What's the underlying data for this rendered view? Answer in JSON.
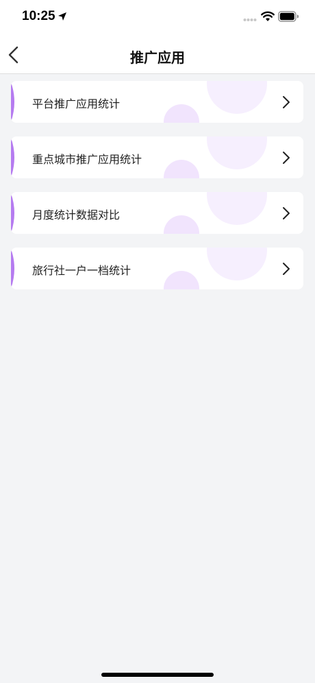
{
  "status_bar": {
    "time": "10:25",
    "icons": [
      "location-arrow-icon",
      "signal-dots-icon",
      "wifi-icon",
      "battery-icon"
    ]
  },
  "nav": {
    "back_icon": "chevron-left-icon",
    "title": "推广应用"
  },
  "menu": {
    "items": [
      {
        "label": "平台推广应用统计",
        "icon": "chevron-right-icon"
      },
      {
        "label": "重点城市推广应用统计",
        "icon": "chevron-right-icon"
      },
      {
        "label": "月度统计数据对比",
        "icon": "chevron-right-icon"
      },
      {
        "label": "旅行社一户一档统计",
        "icon": "chevron-right-icon"
      }
    ]
  },
  "colors": {
    "accent_purple": "#b57bf0",
    "bubble_tint": "#f1e6fd",
    "background": "#f3f4f6"
  }
}
